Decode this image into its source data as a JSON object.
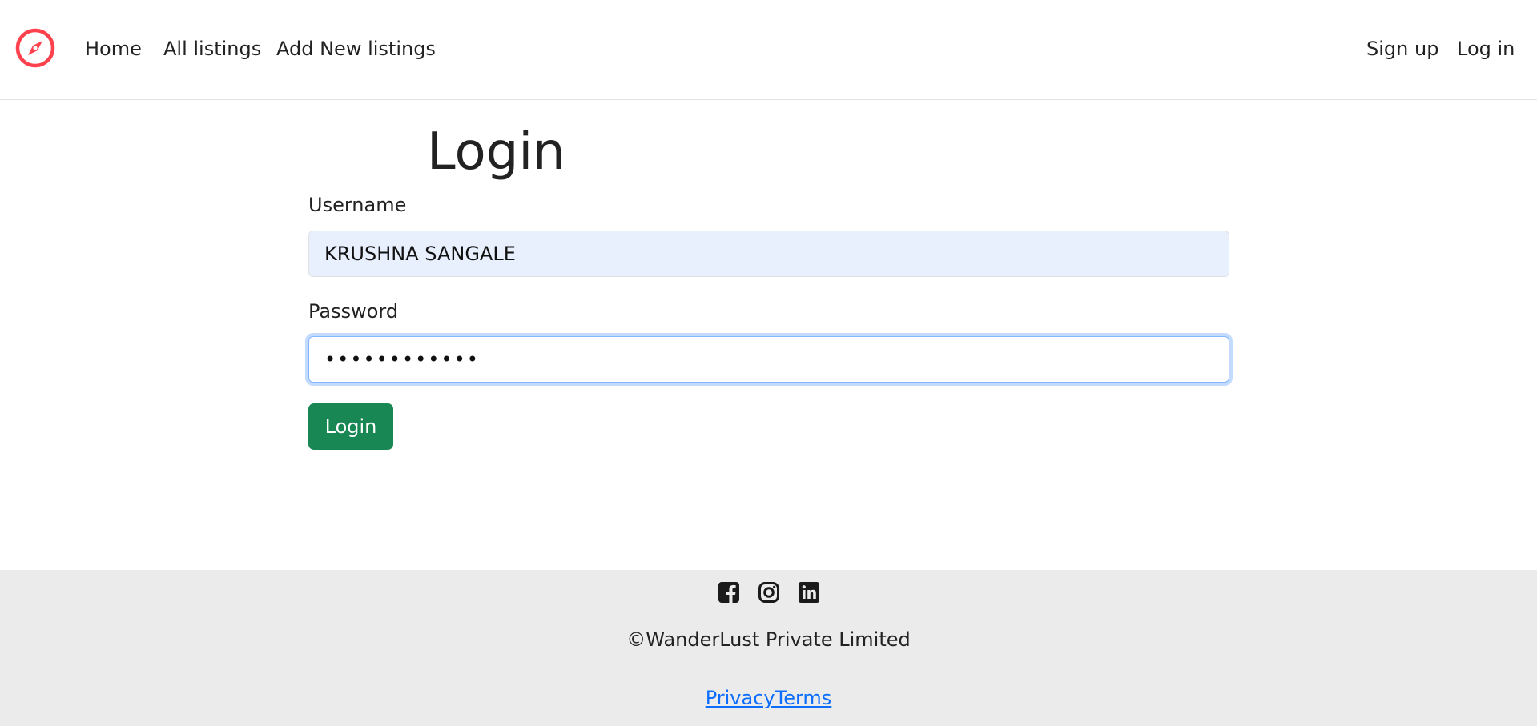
{
  "navbar": {
    "brand_icon": "compass-icon",
    "brand_color": "#fe424d",
    "links": [
      {
        "label": "Home"
      },
      {
        "label": "All listings"
      },
      {
        "label": "Add New listings"
      }
    ],
    "auth_links": [
      {
        "label": "Sign up"
      },
      {
        "label": "Log in"
      }
    ]
  },
  "main": {
    "title": "Login",
    "username": {
      "label": "Username",
      "value": "KRUSHNA SANGALE"
    },
    "password": {
      "label": "Password",
      "value": "••••••••••••"
    },
    "submit_label": "Login",
    "submit_color": "#198754"
  },
  "footer": {
    "social_icons": [
      "facebook-icon",
      "instagram-icon",
      "linkedin-icon"
    ],
    "copyright": "©WanderLust Private Limited",
    "links": [
      {
        "label": "Privacy"
      },
      {
        "label": "Terms"
      }
    ],
    "link_color": "#0d6efd"
  }
}
